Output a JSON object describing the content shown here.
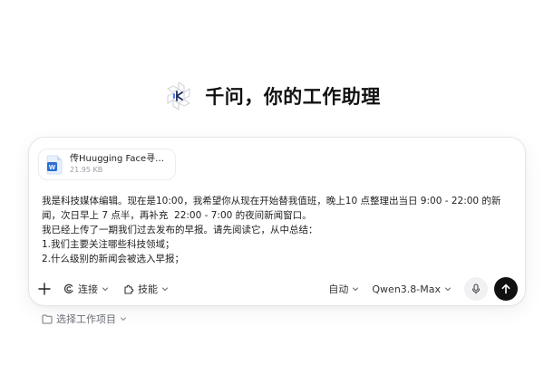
{
  "hero": {
    "title": "千问，你的工作助理"
  },
  "attachment": {
    "file_name": "传Huugging Face寻求出...",
    "file_size": "21.95 KB",
    "file_icon": "word-icon"
  },
  "message": {
    "lines": [
      "我是科技媒体编辑。现在是10:00，我希望你从现在开始替我值班，晚上10 点整理出当日 9:00 - 22:00 的新闻，次日早上 7 点半，再补充  22:00 - 7:00 的夜间新闻窗口。",
      "我已经上传了一期我们过去发布的早报。请先阅读它，从中总结：",
      "1.我们主要关注哪些科技领域；",
      "2.什么级别的新闻会被选入早报；"
    ]
  },
  "toolbar": {
    "add_icon": "plus-icon",
    "connect_label": "连接",
    "skills_label": "技能",
    "mode_label": "自动",
    "model_label": "Qwen3.8-Max",
    "mic_icon": "microphone-icon",
    "send_icon": "arrow-up-icon"
  },
  "project": {
    "label": "选择工作项目",
    "icon": "folder-icon"
  },
  "colors": {
    "send_button": "#111111",
    "word_blue": "#2b6fd6",
    "logo_blue": "#3b6cf6"
  }
}
